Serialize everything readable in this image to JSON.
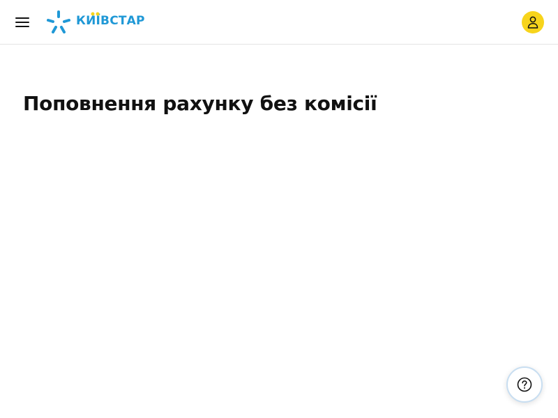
{
  "header": {
    "menu_icon": "hamburger-menu-icon",
    "logo_text": "КИЇВСТАР",
    "logo_color": "#1f98d6",
    "logo_dots_color": "#f7d41c",
    "profile_icon": "user-icon",
    "profile_bg": "#f7d41c"
  },
  "main": {
    "title": "Поповнення рахунку без комісії"
  },
  "help": {
    "icon": "question-icon",
    "border_color": "#c8def1"
  }
}
